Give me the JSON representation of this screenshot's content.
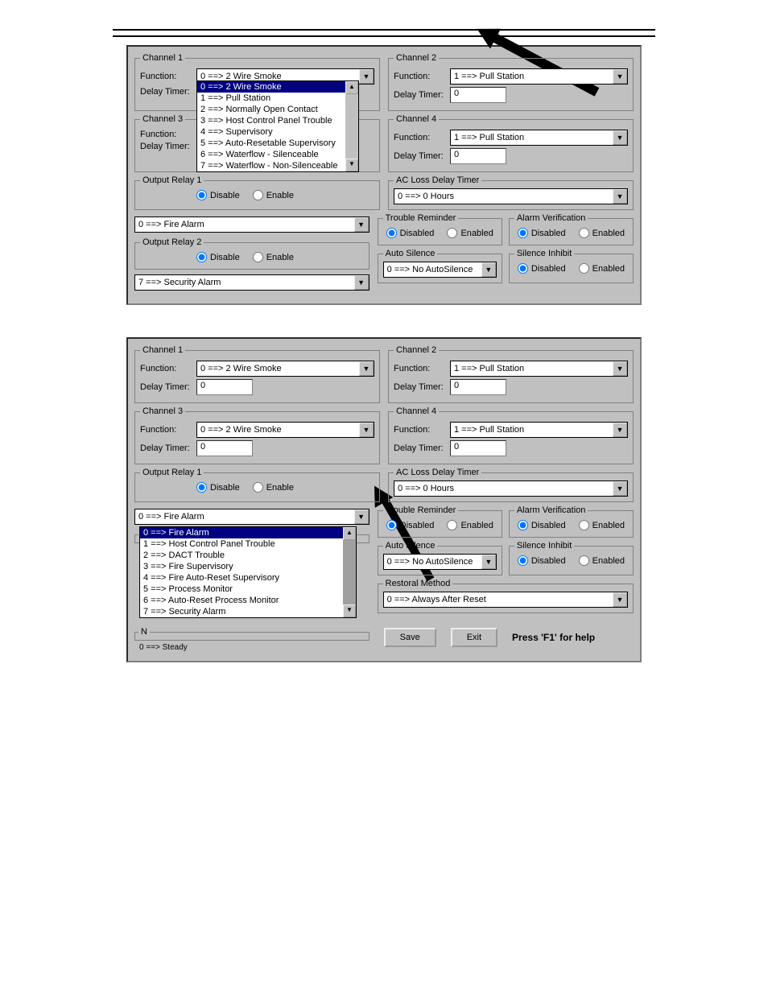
{
  "labels": {
    "function": "Function:",
    "delay_timer": "Delay Timer:",
    "disable": "Disable",
    "enable": "Enable",
    "disabled": "Disabled",
    "enabled": "Enabled",
    "save": "Save",
    "exit": "Exit",
    "help": "Press 'F1' for help"
  },
  "group_titles": {
    "channel1": "Channel 1",
    "channel2": "Channel 2",
    "channel3": "Channel 3",
    "channel4": "Channel 4",
    "output_relay1": "Output Relay 1",
    "output_relay2": "Output Relay 2",
    "ac_loss": "AC Loss Delay Timer",
    "trouble_reminder": "Trouble Reminder",
    "alarm_verification": "Alarm Verification",
    "auto_silence": "Auto Silence",
    "silence_inhibit": "Silence Inhibit",
    "restoral_method": "Restoral Method",
    "n": "N"
  },
  "values": {
    "two_wire_smoke": "0  ==>  2 Wire Smoke",
    "pull_station": "1  ==>  Pull Station",
    "delay0": "0",
    "fire_alarm": "0 ==>  Fire Alarm",
    "security_alarm": "7 ==>  Security Alarm",
    "ac_loss_0h": "0 ==>  0 Hours",
    "no_autosilence": "0 ==>  No AutoSilence",
    "always_after_reset": "0 ==>  Always After Reset",
    "steady": "0 ==>  Steady"
  },
  "function_options": [
    "0  ==>  2 Wire Smoke",
    "1  ==>  Pull Station",
    "2  ==>  Normally Open Contact",
    "3  ==>  Host Control Panel Trouble",
    "4  ==>  Supervisory",
    "5  ==>  Auto-Resetable Supervisory",
    "6  ==>  Waterflow - Silenceable",
    "7  ==>  Waterflow - Non-Silenceable"
  ],
  "relay_options": [
    "0 ==>  Fire Alarm",
    "1 ==>  Host Control Panel Trouble",
    "2 ==>  DACT Trouble",
    "3 ==>  Fire Supervisory",
    "4 ==>  Fire Auto-Reset Supervisory",
    "5 ==>  Process Monitor",
    "6 ==>  Auto-Reset Process Monitor",
    "7 ==>  Security Alarm"
  ]
}
